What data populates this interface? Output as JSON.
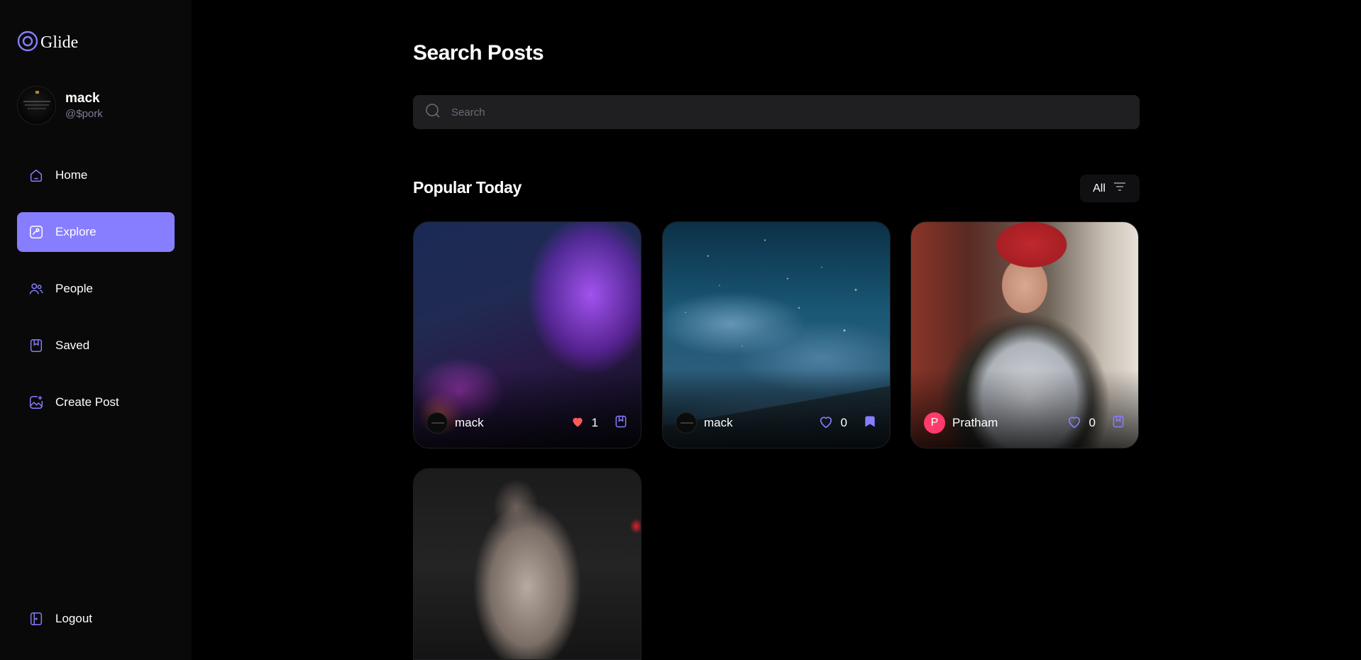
{
  "app": {
    "name": "Glide"
  },
  "user": {
    "name": "mack",
    "handle": "@$pork"
  },
  "nav": {
    "items": [
      {
        "label": "Home",
        "icon": "home-icon",
        "active": false
      },
      {
        "label": "Explore",
        "icon": "explore-icon",
        "active": true
      },
      {
        "label": "People",
        "icon": "people-icon",
        "active": false
      },
      {
        "label": "Saved",
        "icon": "bookmark-icon",
        "active": false
      },
      {
        "label": "Create Post",
        "icon": "create-post-icon",
        "active": false
      }
    ],
    "logout": "Logout"
  },
  "page": {
    "title": "Search Posts",
    "search_placeholder": "Search",
    "section_title": "Popular Today",
    "filter_label": "All"
  },
  "posts": [
    {
      "author": "mack",
      "likes": "1",
      "liked": true,
      "saved": false,
      "image": "motorcycle-rider-purple-smoke"
    },
    {
      "author": "mack",
      "likes": "0",
      "liked": false,
      "saved": true,
      "image": "starry-night-clouds"
    },
    {
      "author": "Pratham",
      "author_initial": "P",
      "likes": "0",
      "liked": false,
      "saved": false,
      "image": "man-red-beanie-vest"
    },
    {
      "image": "muscular-man-gym"
    }
  ],
  "colors": {
    "accent": "#877eff",
    "like": "#ff5a5a",
    "sidebar": "#09090a",
    "input": "#1f1f22"
  }
}
